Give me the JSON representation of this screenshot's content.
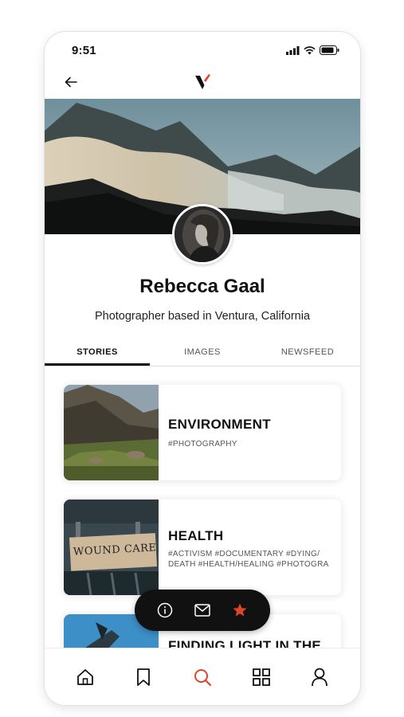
{
  "status_bar": {
    "time": "9:51"
  },
  "profile": {
    "name": "Rebecca Gaal",
    "bio": "Photographer based in Ventura, California"
  },
  "tabs": [
    {
      "label": "STORIES",
      "active": true
    },
    {
      "label": "IMAGES",
      "active": false
    },
    {
      "label": "NEWSFEED",
      "active": false
    }
  ],
  "stories": [
    {
      "title": "ENVIRONMENT",
      "tags": "#PHOTOGRAPHY"
    },
    {
      "title": "HEALTH",
      "tags": "#ACTIVISM #DOCUMENTARY #DYING/ DEATH #HEALTH/HEALING #PHOTOGRA",
      "image_text": "WOUND CARE"
    },
    {
      "title": "FINDING LIGHT IN THE",
      "tags": ""
    }
  ],
  "action_bar": {
    "icons": [
      "info-icon",
      "mail-icon",
      "star-icon"
    ]
  },
  "bottom_nav": {
    "icons": [
      "home-icon",
      "bookmark-icon",
      "search-icon",
      "grid-icon",
      "user-icon"
    ],
    "active": "search-icon"
  },
  "colors": {
    "accent": "#e0452a",
    "dark": "#111111"
  }
}
